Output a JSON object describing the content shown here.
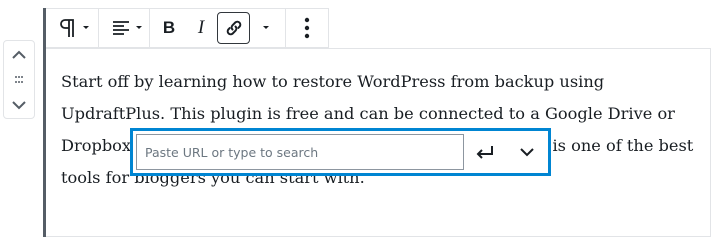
{
  "toolbar": {
    "icons": [
      "paragraph-icon",
      "dropdown-caret-icon",
      "align-left-icon",
      "dropdown-caret-icon",
      "bold-icon",
      "italic-icon",
      "link-icon",
      "dropdown-caret-icon",
      "more-options-icon"
    ],
    "bold_label": "B",
    "italic_label": "I"
  },
  "mover": {
    "icons": [
      "chevron-up-icon",
      "drag-handle-icon",
      "chevron-down-icon"
    ]
  },
  "content": {
    "text": "Start off by learning how to restore WordPress from backup using UpdraftPlus. This plugin is free and can be connected to a Google Drive or Dropbox account for safe storage of your backup files. This is one of the best tools for bloggers you can start with."
  },
  "link_popover": {
    "placeholder": "Paste URL or type to search",
    "value": "",
    "icons": [
      "enter-return-icon",
      "chevron-down-icon"
    ],
    "border_color": "#0085d2"
  }
}
